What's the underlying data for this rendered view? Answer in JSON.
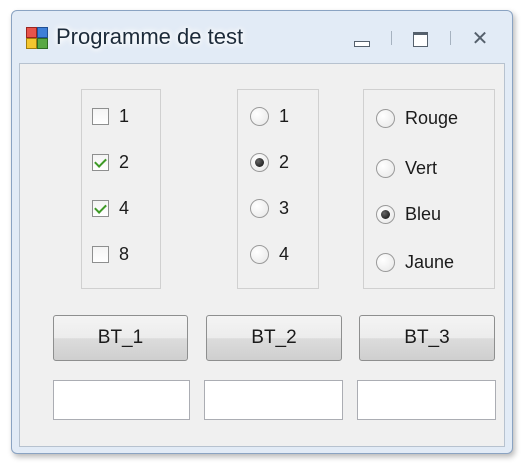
{
  "window": {
    "title": "Programme de test",
    "icon": "winforms-app-icon",
    "controls": [
      "minimize-icon",
      "restore-icon",
      "close-icon"
    ],
    "close_glyph": "✕"
  },
  "checkbox_group": {
    "items": [
      {
        "label": "1",
        "checked": false
      },
      {
        "label": "2",
        "checked": true
      },
      {
        "label": "4",
        "checked": true
      },
      {
        "label": "8",
        "checked": false
      }
    ]
  },
  "number_radio_group": {
    "items": [
      {
        "label": "1",
        "selected": false
      },
      {
        "label": "2",
        "selected": true
      },
      {
        "label": "3",
        "selected": false
      },
      {
        "label": "4",
        "selected": false
      }
    ]
  },
  "color_radio_group": {
    "items": [
      {
        "label": "Rouge",
        "selected": false
      },
      {
        "label": "Vert",
        "selected": false
      },
      {
        "label": "Bleu",
        "selected": true
      },
      {
        "label": "Jaune",
        "selected": false
      }
    ]
  },
  "buttons": [
    {
      "label": "BT_1"
    },
    {
      "label": "BT_2"
    },
    {
      "label": "BT_3"
    }
  ],
  "textboxes": [
    {
      "value": ""
    },
    {
      "value": ""
    },
    {
      "value": ""
    }
  ],
  "colors": {
    "checkmark": "#3e9a26",
    "title_text": "#1d2b3a",
    "window_frame": "#e2ebf6",
    "client_bg": "#f0f0f0"
  }
}
